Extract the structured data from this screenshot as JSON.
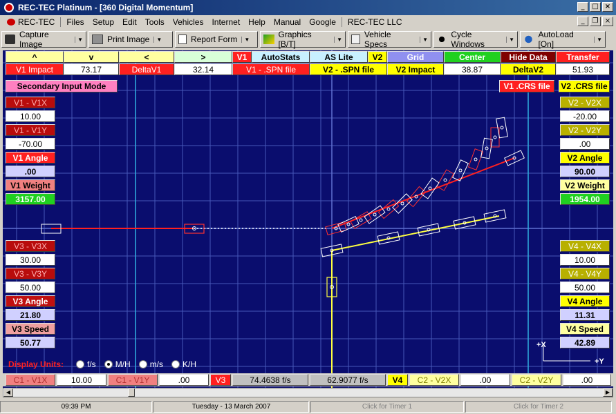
{
  "window": {
    "title": "REC-TEC Platinum - [360 Digital Momentum]"
  },
  "menu": [
    "REC-TEC",
    "Files",
    "Setup",
    "Edit",
    "Tools",
    "Vehicles",
    "Internet",
    "Help",
    "Manual",
    "Google",
    "REC-TEC LLC"
  ],
  "toolbar": {
    "capture": "Capture Image",
    "print": "Print Image",
    "report": "Report Form",
    "graphics": "Graphics [B/T]",
    "specs": "Vehicle Specs",
    "cycle": "Cycle Windows",
    "autoload": "AutoLoad [On]"
  },
  "top_row1": {
    "up": "^",
    "down": "v",
    "left": "<",
    "right": ">",
    "v1": "V1",
    "autostats": "AutoStats",
    "aslite": "AS Lite",
    "v2": "V2",
    "grid": "Grid",
    "center": "Center",
    "hide": "Hide Data",
    "transfer": "Transfer"
  },
  "top_row2": {
    "v1_impact": "V1 Impact",
    "v1_impact_val": "73.17",
    "deltav1": "DeltaV1",
    "deltav1_val": "32.14",
    "v1_spn": "V1 - .SPN file",
    "v2_spn": "V2 - .SPN file",
    "v2_impact": "V2 Impact",
    "v2_impact_val": "38.87",
    "deltav2": "DeltaV2",
    "deltav2_val": "51.93"
  },
  "secondary_mode": "Secondary Input Mode",
  "v1_crs": "V1 .CRS file",
  "v2_crs": "V2 .CRS file",
  "left": {
    "v1x_label": "V1 - V1X",
    "v1x": "10.00",
    "v1y_label": "V1 - V1Y",
    "v1y": "-70.00",
    "v1_angle_label": "V1 Angle",
    "v1_angle": ".00",
    "v1_weight_label": "V1 Weight",
    "v1_weight": "3157.00",
    "v3x_label": "V3 - V3X",
    "v3x": "30.00",
    "v3y_label": "V3 - V3Y",
    "v3y": "50.00",
    "v3_angle_label": "V3 Angle",
    "v3_angle": "21.80",
    "v3_speed_label": "V3 Speed",
    "v3_speed": "50.77"
  },
  "right": {
    "v2x_label": "V2 - V2X",
    "v2x": "-20.00",
    "v2y_label": "V2 - V2Y",
    "v2y": ".00",
    "v2_angle_label": "V2 Angle",
    "v2_angle": "90.00",
    "v2_weight_label": "V2 Weight",
    "v2_weight": "1954.00",
    "v4x_label": "V4 - V4X",
    "v4x": "10.00",
    "v4y_label": "V4 - V4Y",
    "v4y": "50.00",
    "v4_angle_label": "V4 Angle",
    "v4_angle": "11.31",
    "v4_speed_label": "V4 Speed",
    "v4_speed": "42.89"
  },
  "units": {
    "label": "Display Units:",
    "options": [
      "f/s",
      "M/H",
      "m/s",
      "K/H"
    ],
    "selected": "M/H"
  },
  "axes": {
    "x": "+X",
    "y": "+Y"
  },
  "bottom": {
    "c1x_label": "C1 - V1X",
    "c1x": "10.00",
    "c1y_label": "C1 - V1Y",
    "c1y": ".00",
    "v3": "V3",
    "v3_speed_fs": "74.4638  f/s",
    "v4_speed_fs": "62.9077  f/s",
    "v4": "V4",
    "c2x_label": "C2 - V2X",
    "c2x": ".00",
    "c2y_label": "C2 - V2Y",
    "c2y": ".00"
  },
  "status": {
    "time": "09:39 PM",
    "date": "Tuesday  -  13 March 2007",
    "timer1": "Click for Timer 1",
    "timer2": "Click for Timer 2"
  },
  "colors": {
    "background": "#0a0d6e",
    "grid": "#4a5ab0",
    "v1_path": "#ff2020",
    "v2_path": "#ffff40"
  }
}
